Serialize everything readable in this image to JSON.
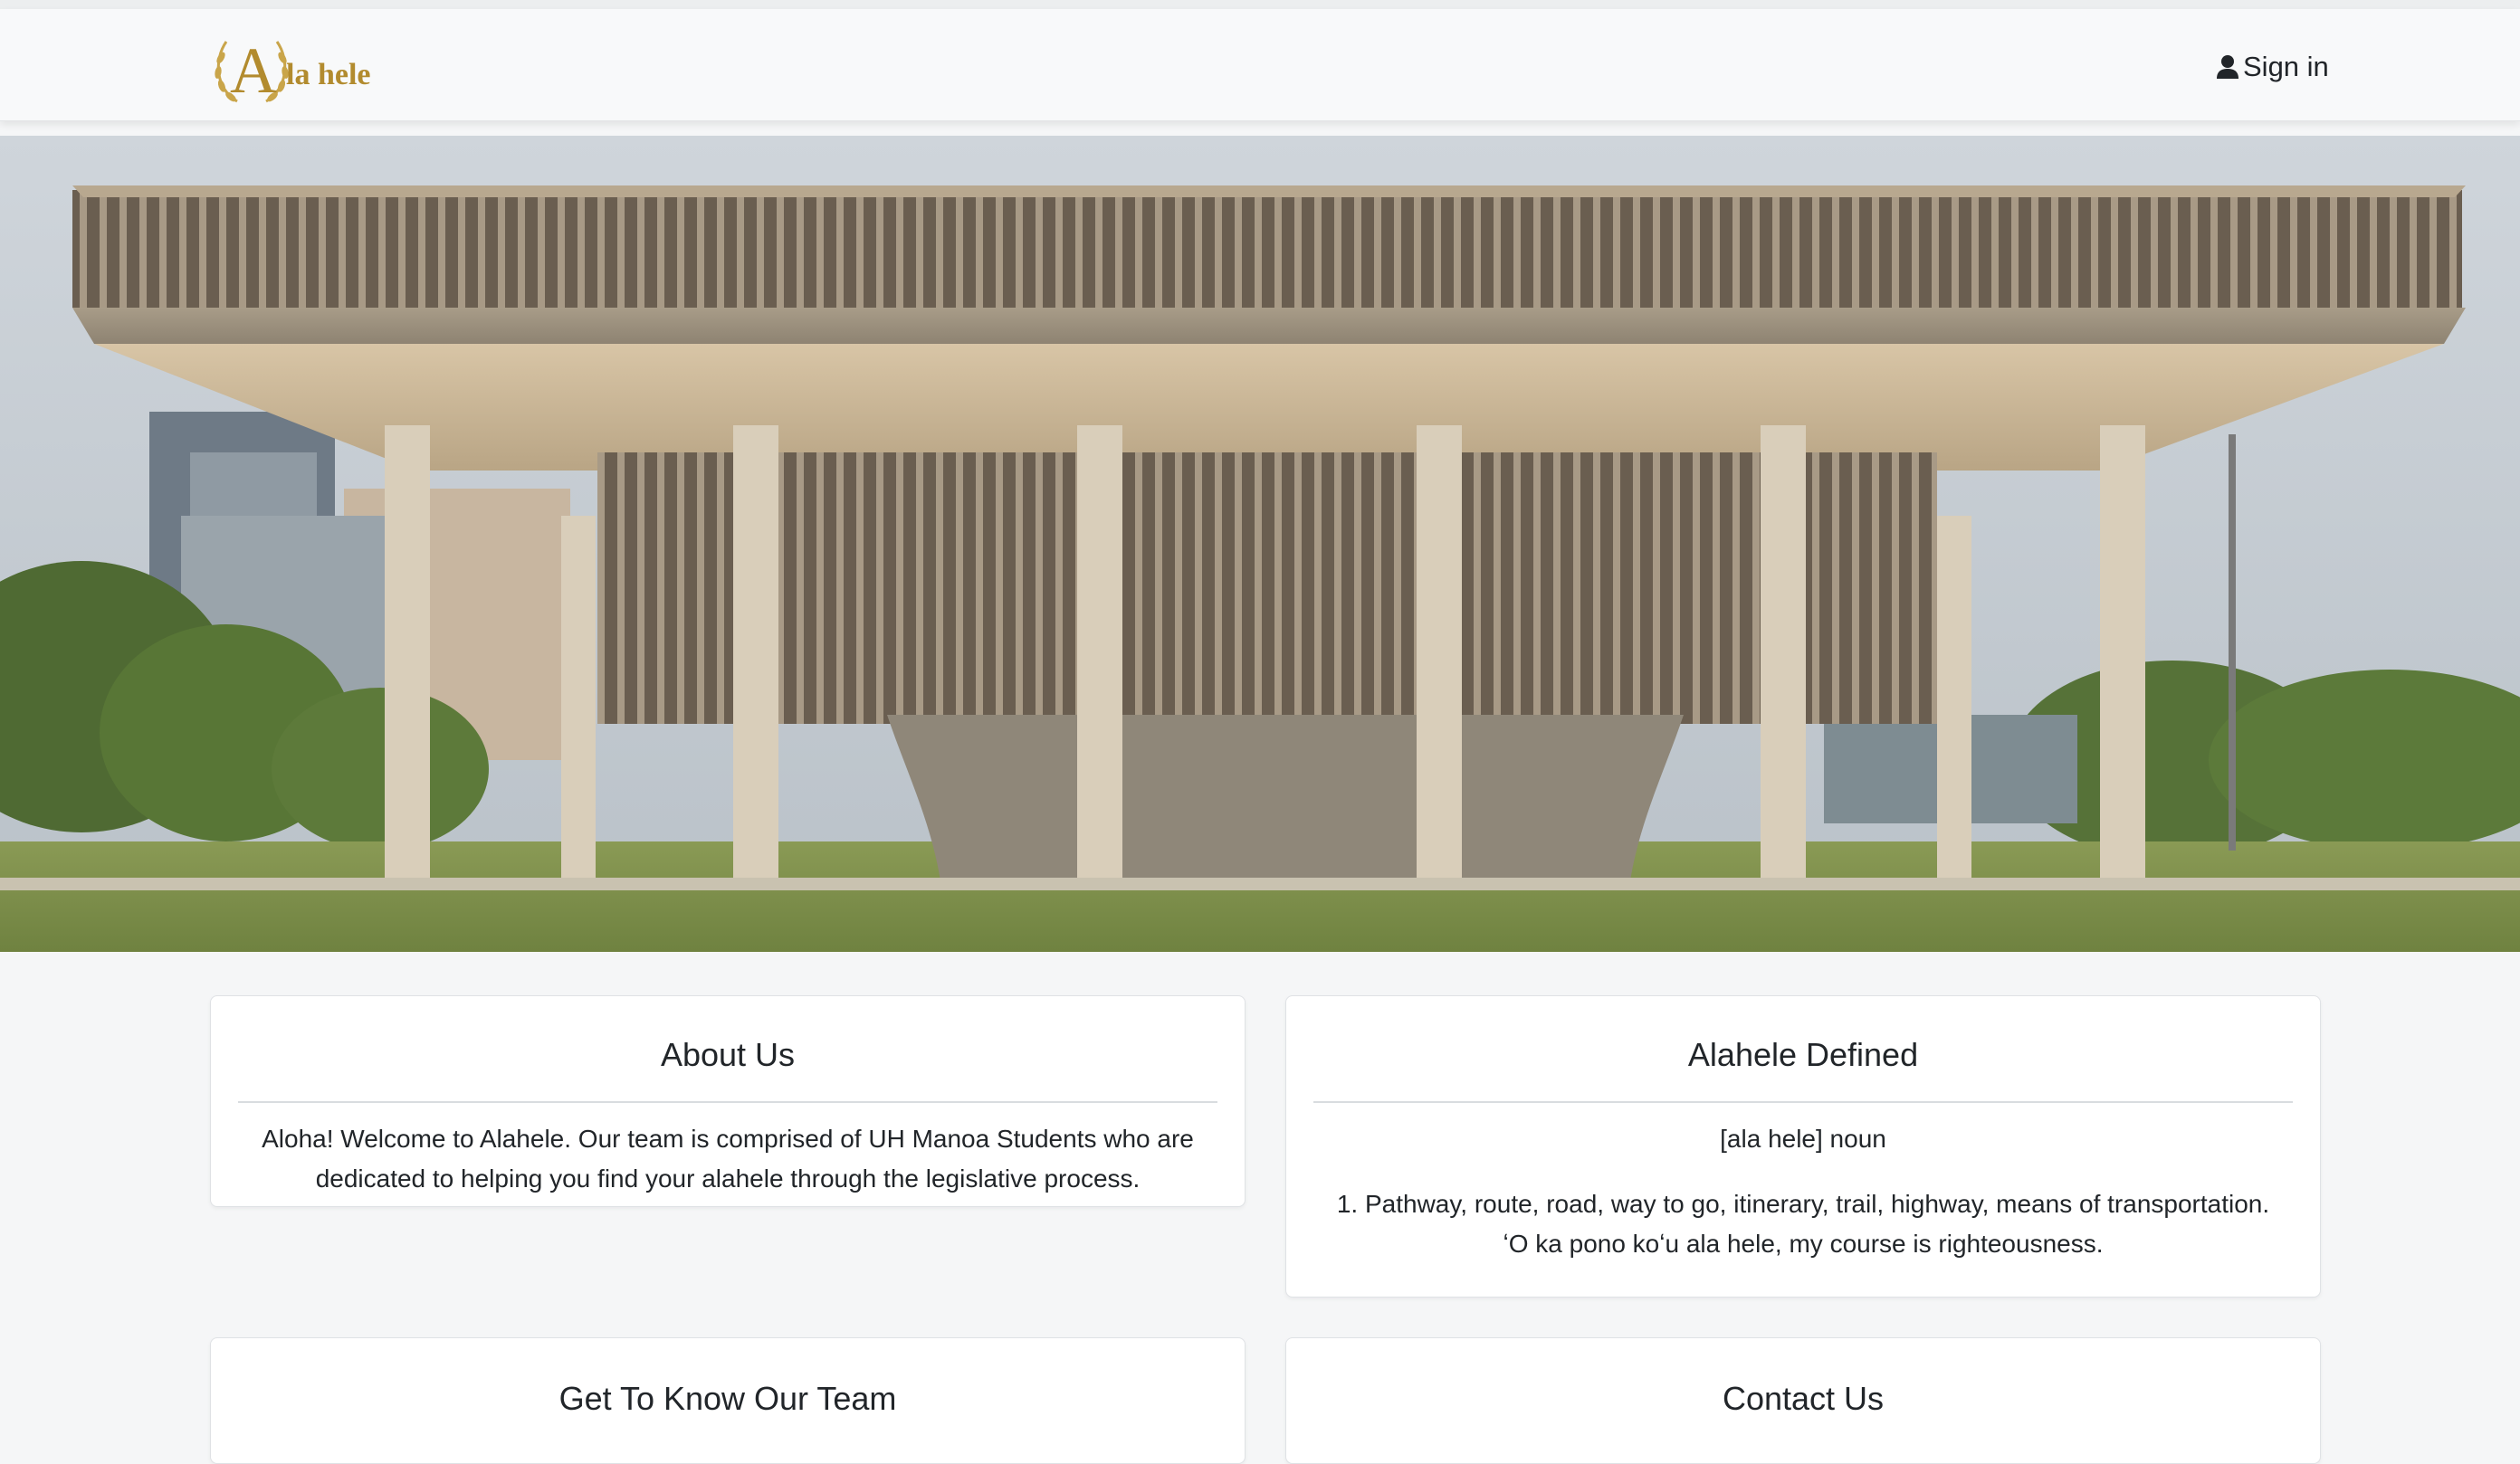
{
  "brand": {
    "logo_letter": "A",
    "logo_text": "la hele",
    "accent_color": "#b28b2e"
  },
  "nav": {
    "signin_icon": "person-icon",
    "signin_label": "Sign in"
  },
  "hero": {
    "subject": "hawaii-state-capitol-building-photo"
  },
  "about": {
    "title": "About Us",
    "body": "Aloha! Welcome to Alahele. Our team is comprised of UH Manoa Students who are dedicated to helping you find your alahele through the legislative process."
  },
  "defined": {
    "title": "Alahele Defined",
    "pronunciation": "[ala hele] noun",
    "definition_line1": "1. Pathway, route, road, way to go, itinerary, trail, highway, means of transportation.",
    "definition_line2": "ʻO ka pono koʻu ala hele, my course is righteousness."
  },
  "team": {
    "title": "Get To Know Our Team"
  },
  "contact": {
    "title": "Contact Us"
  }
}
